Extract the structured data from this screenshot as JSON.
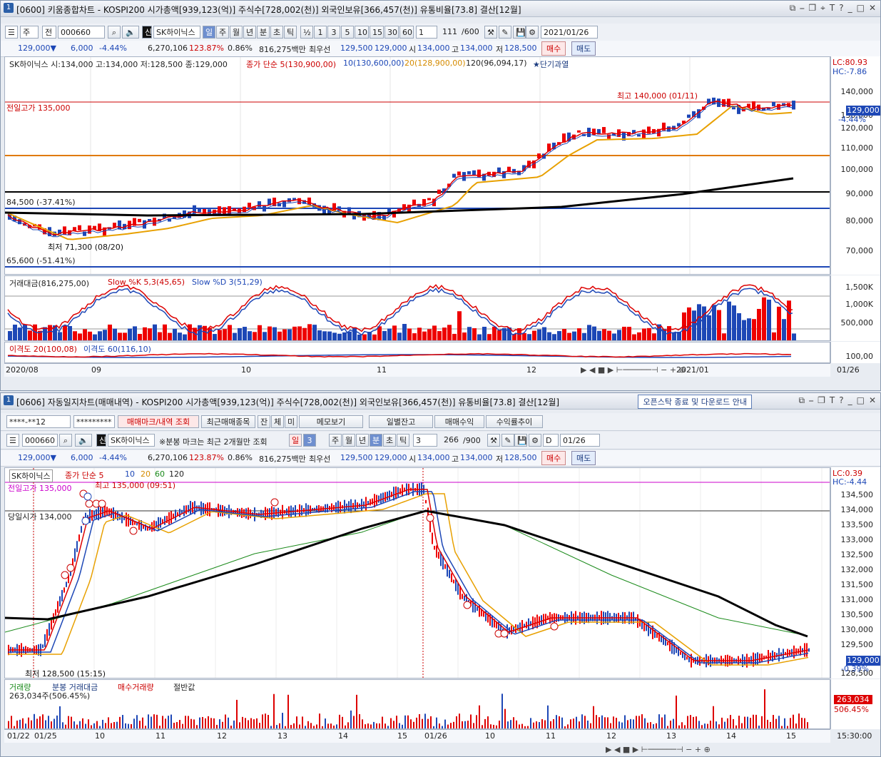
{
  "win1": {
    "num": "1",
    "title": "[0600] 키움종합차트 - KOSPI200 시가총액[939,123(억)] 주식수[728,002(천)] 외국인보유[366,457(천)] 유통비율[73.8] 결산[12월]",
    "toolbar": {
      "mode": "주",
      "type": "전",
      "code": "000660",
      "stock": "SK하이닉스",
      "shin": "신",
      "periods": [
        "일",
        "주",
        "월",
        "년",
        "분",
        "초",
        "틱"
      ],
      "active_period": "일",
      "half": "½",
      "nums": [
        "1",
        "3",
        "5",
        "10",
        "15",
        "30",
        "60"
      ],
      "count": "1",
      "bars": "111",
      "maxbars": "/600",
      "date": "2021/01/26"
    },
    "price": {
      "current": "129,000▼",
      "change": "6,000",
      "rate": "-4.44%",
      "volume": "6,270,106",
      "vol_ratio": "123.87%",
      "turnover": "0.86%",
      "amount": "816,275백만",
      "best_label": "최우선",
      "bid": "129,500",
      "ask": "129,000",
      "open_label": "시",
      "open": "134,000",
      "high_label": "고",
      "high": "134,000",
      "low_label": "저",
      "low": "128,500",
      "buy": "매수",
      "sell": "매도"
    },
    "legend": {
      "stock": "SK하이닉스 시:134,000 고:134,000 저:128,500 종:129,000",
      "ma_title": "종가 단순 5(130,900,00)",
      "ma10": "10(130,600,00)",
      "ma20": "20(128,900,00)",
      "ma120": "120(96,094,17)",
      "signal": "★단기과열"
    },
    "lc": "LC:80.93",
    "hc": "HC:-7.86",
    "labels": {
      "prev_high": "전일고가 135,000",
      "max": "최고 140,000 (01/11)",
      "min": "최저 71,300 (08/20)",
      "lvl1": "84,500 (-37.41%)",
      "lvl2": "65,600 (-51.41%)",
      "tag_price": "129,000",
      "tag_rate": "-4.44%"
    },
    "yaxis": [
      "140,000",
      "130,000",
      "120,000",
      "110,000",
      "100,000",
      "90,000",
      "80,000",
      "70,000"
    ],
    "sub1_legend": {
      "a": "거래대금(816,275,00)",
      "b": "Slow %K 5,3(45,65)",
      "c": "Slow %D 3(51,29)"
    },
    "sub1_axis": [
      "1,500K",
      "1,000K",
      "500,000"
    ],
    "sub2_legend": {
      "a": "이격도 20(100,08)",
      "b": "이격도 60(116,10)"
    },
    "sub2_axis": [
      "100,00"
    ],
    "dates": [
      "2020/08",
      "09",
      "10",
      "11",
      "12",
      "2021/01"
    ],
    "date_right": "01/26"
  },
  "win2": {
    "num": "1",
    "title": "[0606] 자동일지차트(매매내역) - KOSPI200 시가총액[939,123(억)] 주식수[728,002(천)] 외국인보유[366,457(천)] 유통비율[73.8] 결산[12월]",
    "notice": "오픈스탁 종료 및 다운로드 안내",
    "row1": {
      "account": "****-**12",
      "password": "*********",
      "mark_btn": "매매마크/내역 조회",
      "recent": "최근매매종목",
      "jan": "잔",
      "che": "체",
      "mi": "미",
      "memo": "메모보기",
      "daily": "일별잔고",
      "profit": "매매수익",
      "trend": "수익률추이"
    },
    "row2": {
      "code": "000660",
      "stock": "SK하이닉스",
      "shin": "신",
      "note": "※분봉 마크는 최근 2개월만 조회",
      "day": "일",
      "n3": "3",
      "periods": [
        "주",
        "월",
        "년",
        "분",
        "초",
        "틱"
      ],
      "active": "분",
      "mins": "3",
      "bars": "266",
      "maxbars": "/900",
      "d": "D",
      "date": "01/26"
    },
    "price": {
      "current": "129,000▼",
      "change": "6,000",
      "rate": "-4.44%",
      "volume": "6,270,106",
      "vol_ratio": "123.87%",
      "turnover": "0.86%",
      "amount": "816,275백만",
      "best_label": "최우선",
      "bid": "129,500",
      "ask": "129,000",
      "open_label": "시",
      "open": "134,000",
      "high_label": "고",
      "high": "134,000",
      "low_label": "저",
      "low": "128,500",
      "buy": "매수",
      "sell": "매도"
    },
    "legend": {
      "stock": "SK하이닉스",
      "ma": "종가 단순 5",
      "m10": "10",
      "m20": "20",
      "m60": "60",
      "m120": "120"
    },
    "lc": "LC:0.39",
    "hc": "HC:-4.44",
    "labels": {
      "prev_high": "전일고가 135,000",
      "max": "최고 135,000 (09:51)",
      "today_open": "당일시가 134,000",
      "min": "최저 128,500 (15:15)",
      "tag_price": "129,000",
      "tag_rate": "-0.39%"
    },
    "yaxis": [
      "134,500",
      "134,000",
      "133,500",
      "133,000",
      "132,500",
      "132,000",
      "131,500",
      "131,000",
      "130,500",
      "130,000",
      "129,500",
      "128,500"
    ],
    "sub_legend": {
      "a": "거래량",
      "b": "분봉 거래대금",
      "c": "매수거래량",
      "d": "절반값",
      "e": "263,034주(506.45%)"
    },
    "sub_tag": {
      "a": "263,034",
      "b": "506.45%"
    },
    "dates": [
      "01/22",
      "01/25",
      "10",
      "11",
      "12",
      "13",
      "14",
      "15",
      "01/26",
      "10",
      "11",
      "12",
      "13",
      "14",
      "15"
    ],
    "date_right": "15:30:00"
  }
}
